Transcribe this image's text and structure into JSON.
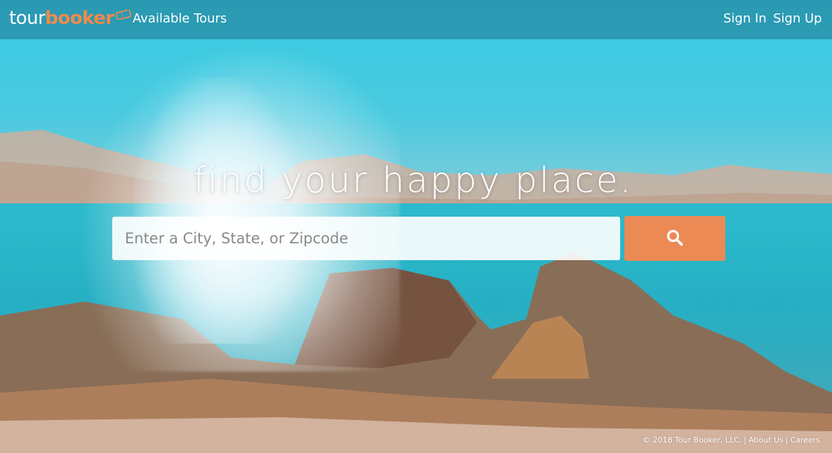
{
  "brand": {
    "tour": "tour",
    "booker": "booker",
    "tour_color": "#ffffff",
    "booker_color": "#f08a4b"
  },
  "nav": {
    "available_tours": "Available Tours",
    "sign_in": "Sign In",
    "sign_up": "Sign Up",
    "bar_color": "#2a8ca5"
  },
  "hero": {
    "headline": "find your happy place.",
    "search_placeholder": "Enter a City, State, or Zipcode",
    "search_value": "",
    "search_button_icon": "search-icon",
    "accent_color": "#ec8a55"
  },
  "footer": {
    "copyright": "© 2018 Tour Booker, LLC.",
    "sep1": "|",
    "about": "About Us",
    "sep2": "|",
    "careers": "Careers"
  }
}
